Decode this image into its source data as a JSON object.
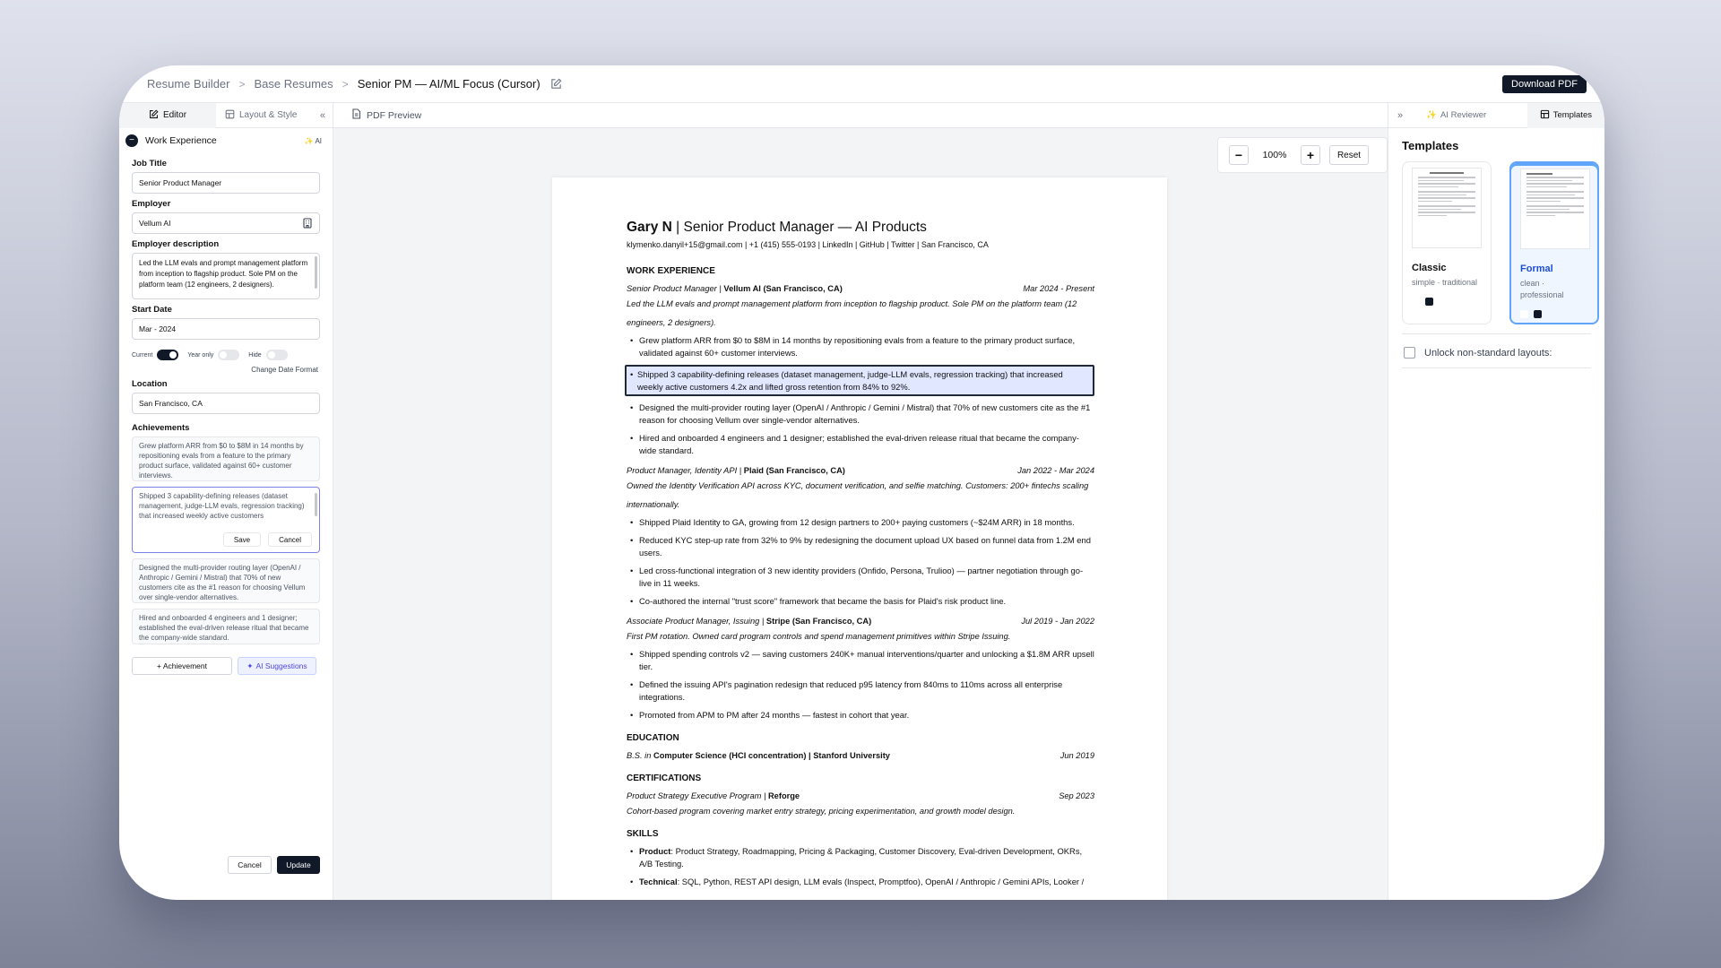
{
  "breadcrumb": {
    "items": [
      "Resume Builder",
      "Base Resumes"
    ],
    "current": "Senior PM — AI/ML Focus (Cursor)"
  },
  "download_label": "Download PDF",
  "left_tabs": {
    "editor": "Editor",
    "layout": "Layout & Style"
  },
  "section": {
    "title": "Work Experience",
    "ai": "AI"
  },
  "form": {
    "job_title_label": "Job Title",
    "job_title": "Senior Product Manager",
    "employer_label": "Employer",
    "employer": "Vellum AI",
    "desc_label": "Employer description",
    "desc": "Led the LLM evals and prompt management platform from inception to flagship product. Sole PM on the platform team (12 engineers, 2 designers).",
    "start_label": "Start Date",
    "start": "Mar - 2024",
    "toggles": {
      "current": "Current",
      "year_only": "Year only",
      "hide": "Hide"
    },
    "change_date": "Change Date Format",
    "location_label": "Location",
    "location": "San Francisco, CA",
    "achievements_label": "Achievements",
    "achievements": [
      "Grew platform ARR from $0 to $8M in 14 months by repositioning evals from a feature to the primary product surface, validated against 60+ customer interviews.",
      "Shipped 3 capability-defining releases (dataset management, judge-LLM evals, regression tracking) that increased weekly active customers",
      "Designed the multi-provider routing layer (OpenAI / Anthropic / Gemini / Mistral) that 70% of new customers cite as the #1 reason for choosing Vellum over single-vendor alternatives.",
      "Hired and onboarded 4 engineers and 1 designer; established the eval-driven release ritual that became the company-wide standard."
    ],
    "save": "Save",
    "cancel": "Cancel",
    "add_achievement": "+ Achievement",
    "ai_suggestions": "AI Suggestions",
    "footer_cancel": "Cancel",
    "footer_update": "Update"
  },
  "preview": {
    "tab": "PDF Preview",
    "zoom": "100%",
    "reset": "Reset"
  },
  "resume": {
    "name": "Gary N",
    "headline": " | Senior Product Manager — AI Products",
    "contact": "klymenko.danyil+15@gmail.com | +1 (415) 555-0193 | LinkedIn | GitHub | Twitter | San Francisco, CA",
    "h_work": "WORK EXPERIENCE",
    "jobs": [
      {
        "role": "Senior Product Manager",
        "company": "Vellum AI (San Francisco, CA)",
        "dates": "Mar 2024 - Present",
        "desc": "Led the LLM evals and prompt management platform from inception to flagship product. Sole PM on the platform team (12 engineers, 2 designers).",
        "bullets": [
          "Grew platform ARR from $0 to $8M in 14 months by repositioning evals from a feature to the primary product surface, validated against 60+ customer interviews.",
          "Shipped 3 capability-defining releases (dataset management, judge-LLM evals, regression tracking) that increased weekly active customers 4.2x and lifted gross retention from 84% to 92%.",
          "Designed the multi-provider routing layer (OpenAI / Anthropic / Gemini / Mistral) that 70% of new customers cite as the #1 reason for choosing Vellum over single-vendor alternatives.",
          "Hired and onboarded 4 engineers and 1 designer; established the eval-driven release ritual that became the company-wide standard."
        ]
      },
      {
        "role": "Product Manager, Identity API",
        "company": "Plaid (San Francisco, CA)",
        "dates": "Jan 2022 - Mar 2024",
        "desc": "Owned the Identity Verification API across KYC, document verification, and selfie matching. Customers: 200+ fintechs scaling internationally.",
        "bullets": [
          "Shipped Plaid Identity to GA, growing from 12 design partners to 200+ paying customers (~$24M ARR) in 18 months.",
          "Reduced KYC step-up rate from 32% to 9% by redesigning the document upload UX based on funnel data from 1.2M end users.",
          "Led cross-functional integration of 3 new identity providers (Onfido, Persona, Trulioo) — partner negotiation through go-live in 11 weeks.",
          "Co-authored the internal \"trust score\" framework that became the basis for Plaid's risk product line."
        ]
      },
      {
        "role": "Associate Product Manager, Issuing",
        "company": "Stripe (San Francisco, CA)",
        "dates": "Jul 2019 - Jan 2022",
        "desc": "First PM rotation. Owned card program controls and spend management primitives within Stripe Issuing.",
        "bullets": [
          "Shipped spending controls v2 — saving customers 240K+ manual interventions/quarter and unlocking a $1.8M ARR upsell tier.",
          "Defined the issuing API's pagination redesign that reduced p95 latency from 840ms to 110ms across all enterprise integrations.",
          "Promoted from APM to PM after 24 months — fastest in cohort that year."
        ]
      }
    ],
    "h_edu": "EDUCATION",
    "edu": {
      "prefix": "B.S. in ",
      "degree": "Computer Science (HCI concentration) | Stanford University",
      "date": "Jun 2019"
    },
    "h_cert": "CERTIFICATIONS",
    "cert": {
      "name": "Product Strategy Executive Program",
      "org": "Reforge",
      "date": "Sep 2023",
      "desc": "Cohort-based program covering market entry strategy, pricing experimentation, and growth model design."
    },
    "h_skills": "SKILLS",
    "skills": [
      {
        "k": "Product",
        "v": ": Product Strategy, Roadmapping, Pricing & Packaging, Customer Discovery, Eval-driven Development, OKRs, A/B Testing."
      },
      {
        "k": "Technical",
        "v": ": SQL, Python, REST API design, LLM evals (Inspect, Promptfoo), OpenAI / Anthropic / Gemini APIs, Looker /"
      }
    ]
  },
  "right": {
    "tabs": {
      "reviewer": "AI Reviewer",
      "templates": "Templates"
    },
    "title": "Templates",
    "cards": [
      {
        "name": "Classic",
        "desc": "simple · traditional"
      },
      {
        "name": "Formal",
        "desc": "clean · professional"
      }
    ],
    "unlock": "Unlock non-standard layouts:"
  },
  "colors": {
    "accent": "#4f46e5",
    "dark": "#111827",
    "selected": "#60a5fa"
  }
}
